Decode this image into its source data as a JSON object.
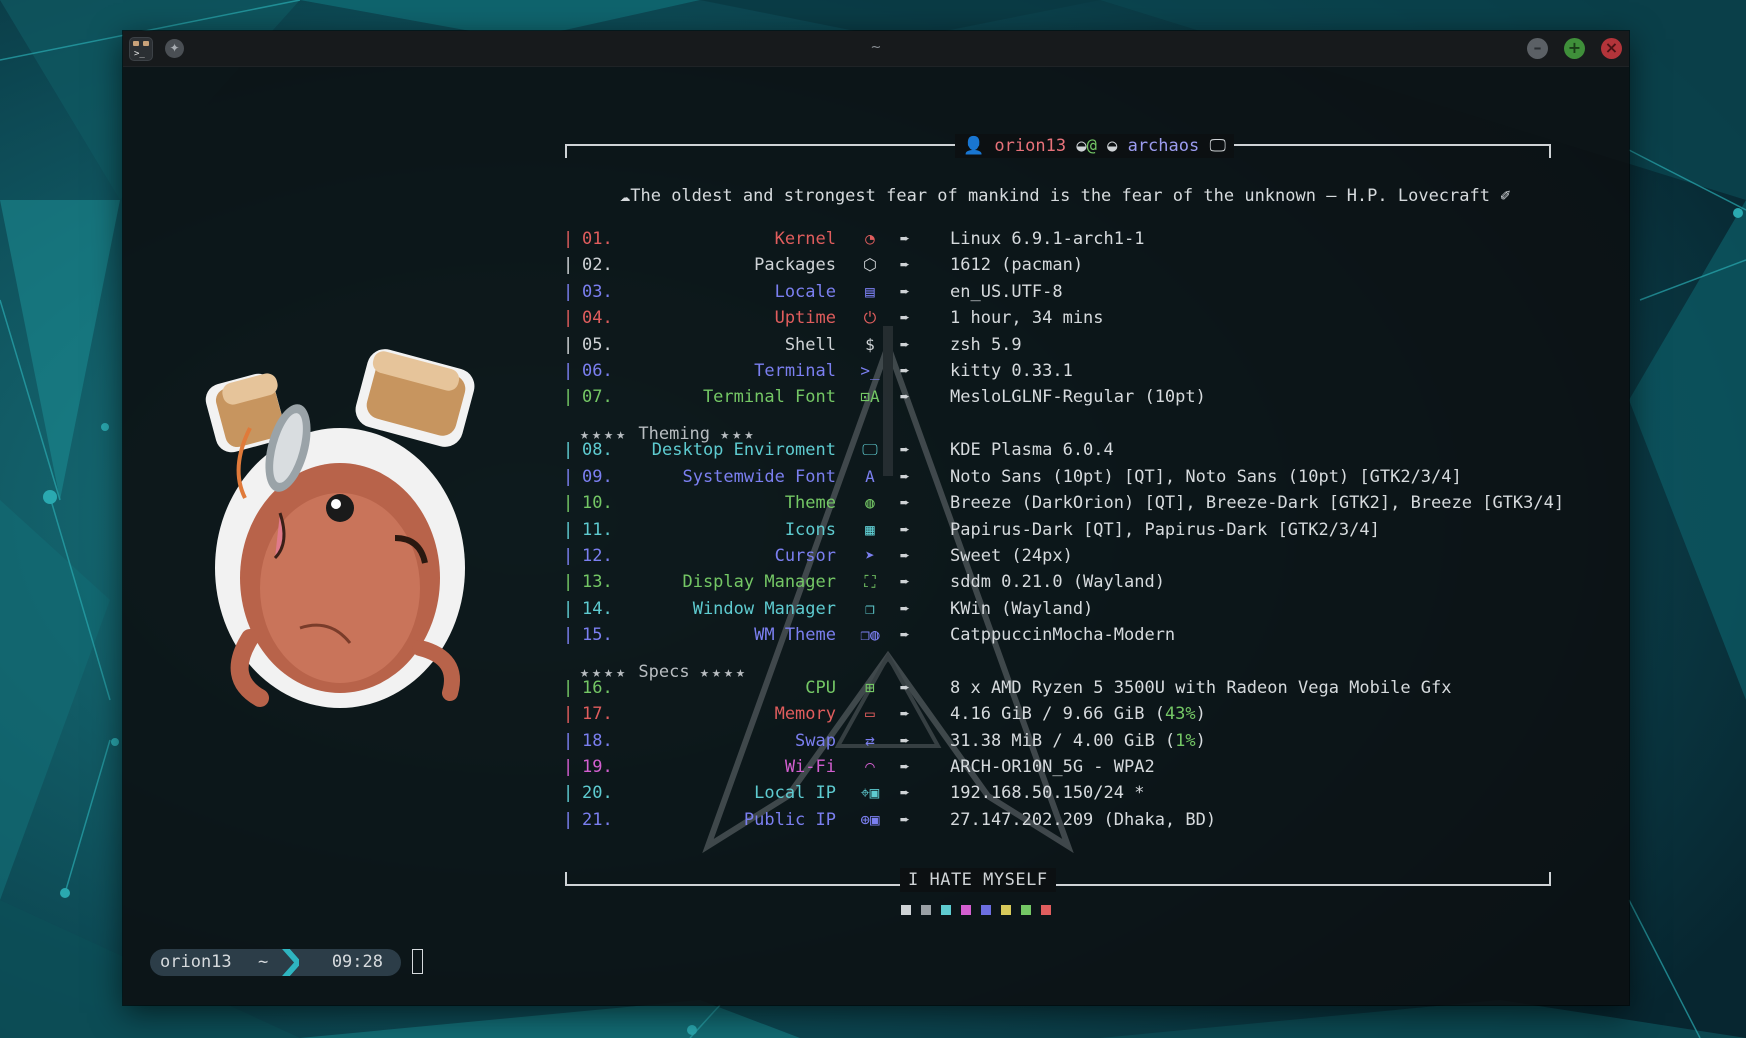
{
  "window": {
    "title": "~"
  },
  "header": {
    "user": "orion13",
    "at": "@",
    "host": "archaos"
  },
  "quote": "The oldest and strongest fear of mankind is the fear of the unknown –  H.P. Lovecraft",
  "rows": [
    {
      "num": "01.",
      "label": "Kernel",
      "value": "Linux 6.9.1-arch1-1",
      "color": "#e05d5d",
      "icon": "kernel-icon",
      "glyph": "◔"
    },
    {
      "num": "02.",
      "label": "Packages",
      "value": "1612 (pacman)",
      "color": "#cfd3d6",
      "icon": "package-icon",
      "glyph": "⬡"
    },
    {
      "num": "03.",
      "label": "Locale",
      "value": "en_US.UTF-8",
      "color": "#7b7ff0",
      "icon": "language-icon",
      "glyph": "▤"
    },
    {
      "num": "04.",
      "label": "Uptime",
      "value": "1 hour, 34 mins",
      "color": "#e05d5d",
      "icon": "power-icon",
      "glyph": "⏻"
    },
    {
      "num": "05.",
      "label": "Shell",
      "value": "zsh 5.9",
      "color": "#cfd3d6",
      "icon": "dollar-icon",
      "glyph": "$"
    },
    {
      "num": "06.",
      "label": "Terminal",
      "value": "kitty 0.33.1",
      "color": "#7b7ff0",
      "icon": "terminal-icon",
      "glyph": ">_"
    },
    {
      "num": "07.",
      "label": "Terminal Font",
      "value": "MesloLGLNF-Regular (10pt)",
      "color": "#74c765",
      "icon": "font-icon",
      "glyph": "⊡A"
    },
    {
      "num": "08.",
      "label": "Desktop Enviroment",
      "value": "KDE Plasma 6.0.4",
      "color": "#5ecbd0",
      "icon": "monitor-icon",
      "glyph": "🖵"
    },
    {
      "num": "09.",
      "label": "Systemwide Font",
      "value": "Noto Sans (10pt) [QT], Noto Sans (10pt) [GTK2/3/4]",
      "color": "#7b7ff0",
      "icon": "font-icon",
      "glyph": "A"
    },
    {
      "num": "10.",
      "label": "Theme",
      "value": "Breeze (DarkOrion) [QT], Breeze-Dark [GTK2], Breeze [GTK3/4]",
      "color": "#74c765",
      "icon": "palette-icon",
      "glyph": "◍"
    },
    {
      "num": "11.",
      "label": "Icons",
      "value": "Papirus-Dark [QT], Papirus-Dark [GTK2/3/4]",
      "color": "#5ecbd0",
      "icon": "icons-icon",
      "glyph": "▦"
    },
    {
      "num": "12.",
      "label": "Cursor",
      "value": "Sweet (24px)",
      "color": "#7b7ff0",
      "icon": "cursor-icon",
      "glyph": "➤"
    },
    {
      "num": "13.",
      "label": "Display Manager",
      "value": "sddm 0.21.0 (Wayland)",
      "color": "#74c765",
      "icon": "display-icon",
      "glyph": "⛶"
    },
    {
      "num": "14.",
      "label": "Window Manager",
      "value": "KWin (Wayland)",
      "color": "#5ecbd0",
      "icon": "windows-icon",
      "glyph": "❐"
    },
    {
      "num": "15.",
      "label": "WM Theme",
      "value": "CatppuccinMocha-Modern",
      "color": "#7b7ff0",
      "icon": "wm-theme-icon",
      "glyph": "❐◍"
    },
    {
      "num": "16.",
      "label": "CPU",
      "value": "8 x AMD Ryzen 5 3500U with Radeon Vega Mobile Gfx",
      "color": "#74c765",
      "icon": "cpu-icon",
      "glyph": "⊞"
    },
    {
      "num": "17.",
      "label": "Memory",
      "value": "4.16 GiB / 9.66 GiB (43%)",
      "color": "#e05d5d",
      "icon": "memory-icon",
      "glyph": "▭"
    },
    {
      "num": "18.",
      "label": "Swap",
      "value": "31.38 MiB / 4.00 GiB (1%)",
      "color": "#7b7ff0",
      "icon": "swap-icon",
      "glyph": "⇄"
    },
    {
      "num": "19.",
      "label": "Wi-Fi",
      "value": "ARCH-OR10N_5G - WPA2",
      "color": "#d35fd0",
      "icon": "wifi-icon",
      "glyph": "◠"
    },
    {
      "num": "20.",
      "label": "Local IP",
      "value": "192.168.50.150/24 *",
      "color": "#5ecbd0",
      "icon": "location-icon",
      "glyph": "⌖▣"
    },
    {
      "num": "21.",
      "label": "Public IP",
      "value": "27.147.202.209 (Dhaka, BD)",
      "color": "#7b7ff0",
      "icon": "globe-icon",
      "glyph": "⊕▣"
    }
  ],
  "sections": {
    "theming": "Theming",
    "specs": "Specs",
    "stars": "★★★★",
    "stars_right": "★★★"
  },
  "footer": "I HATE MYSELF",
  "swatches": [
    "#cfd3d6",
    "#9aa0a5",
    "#5ecbd0",
    "#d35fd0",
    "#6c6ee0",
    "#d7c95a",
    "#74c765",
    "#e05d5d"
  ],
  "prompt": {
    "user": "orion13",
    "dir": "~",
    "time": "09:28"
  }
}
